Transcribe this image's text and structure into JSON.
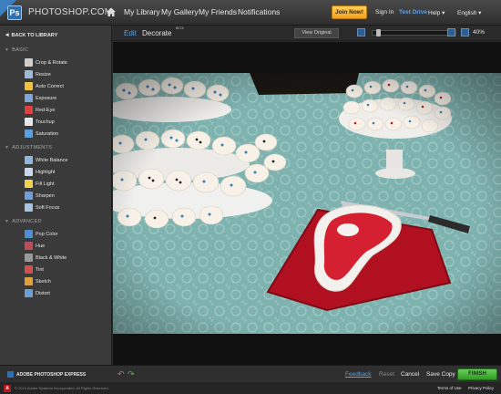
{
  "topbar": {
    "brand": "PHOTOSHOP.COM",
    "logo_letters": "Ps",
    "nav": [
      "My Library",
      "My Gallery",
      "My Friends",
      "Notifications"
    ],
    "join_label": "Join Now!",
    "sign_in": "Sign In",
    "test_drive": "Test Drive",
    "help": "Help ▾",
    "language": "English ▾"
  },
  "sidebar": {
    "back_label": "BACK TO LIBRARY",
    "sections": [
      {
        "title": "BASIC",
        "items": [
          {
            "label": "Crop & Rotate",
            "icon": "crop-icon",
            "color": "#cfcfcf"
          },
          {
            "label": "Resize",
            "icon": "resize-icon",
            "color": "#9fb8d6"
          },
          {
            "label": "Auto Correct",
            "icon": "wand-icon",
            "color": "#f0c040"
          },
          {
            "label": "Exposure",
            "icon": "exposure-icon",
            "color": "#7fa7d6"
          },
          {
            "label": "Red-Eye",
            "icon": "eye-icon",
            "color": "#e04040"
          },
          {
            "label": "Touchup",
            "icon": "hand-icon",
            "color": "#e6e6e6"
          },
          {
            "label": "Saturation",
            "icon": "saturation-icon",
            "color": "#5aa0e0"
          }
        ]
      },
      {
        "title": "ADJUSTMENTS",
        "items": [
          {
            "label": "White Balance",
            "icon": "white-balance-icon",
            "color": "#8fb6e0"
          },
          {
            "label": "Highlight",
            "icon": "highlight-icon",
            "color": "#c9d8ea"
          },
          {
            "label": "Fill Light",
            "icon": "bulb-icon",
            "color": "#f2d24a"
          },
          {
            "label": "Sharpen",
            "icon": "sharpen-icon",
            "color": "#6f9fd4"
          },
          {
            "label": "Soft Focus",
            "icon": "soft-focus-icon",
            "color": "#a8c4e4"
          }
        ]
      },
      {
        "title": "ADVANCED",
        "items": [
          {
            "label": "Pop Color",
            "icon": "pop-color-icon",
            "color": "#4f8fd0"
          },
          {
            "label": "Hue",
            "icon": "hue-icon",
            "color": "#c04a5a"
          },
          {
            "label": "Black & White",
            "icon": "bw-icon",
            "color": "#9a9a9a"
          },
          {
            "label": "Tint",
            "icon": "tint-icon",
            "color": "#d05050"
          },
          {
            "label": "Sketch",
            "icon": "pencil-icon",
            "color": "#e0a040"
          },
          {
            "label": "Distort",
            "icon": "distort-icon",
            "color": "#6aa0d8"
          }
        ]
      }
    ]
  },
  "editor": {
    "mode_edit": "Edit",
    "mode_decorate": "Decorate",
    "beta_tag": "BETA",
    "view_original": "View Original",
    "zoom": "40%",
    "zoom_level": 0.4
  },
  "bottom": {
    "product": "ADOBE PHOTOSHOP EXPRESS",
    "feedback": "Feedback",
    "reset": "Reset",
    "cancel": "Cancel",
    "save_copy": "Save Copy",
    "finish": "FINISH"
  },
  "footer": {
    "copyright": "© 2010 Adobe Systems Incorporated. All Rights Reserved.",
    "terms": "Terms of Use",
    "privacy": "Privacy Policy"
  },
  "colors": {
    "accent_blue": "#5fa0df",
    "join_orange": "#f3a21a",
    "finish_green": "#3aa82c",
    "tablecloth": "#7fb3b0",
    "tray_red": "#b01020"
  }
}
